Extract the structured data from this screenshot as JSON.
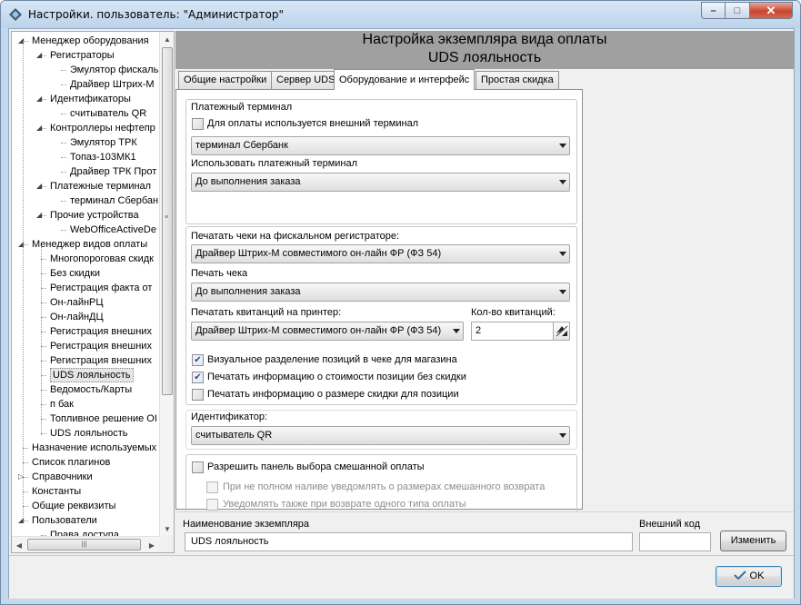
{
  "window": {
    "title": "Настройки. пользователь: \"Администратор\"",
    "buttons": {
      "minimize": "–",
      "maximize": "□",
      "close": "✕"
    }
  },
  "tree": {
    "items": [
      {
        "label": "Менеджер оборудования",
        "level": 0,
        "expander": "minus"
      },
      {
        "label": "Регистраторы",
        "level": 1,
        "expander": "minus"
      },
      {
        "label": "Эмулятор фискаль",
        "level": 2
      },
      {
        "label": "Драйвер Штрих-М",
        "level": 2
      },
      {
        "label": "Идентификаторы",
        "level": 1,
        "expander": "minus"
      },
      {
        "label": "считыватель QR",
        "level": 2
      },
      {
        "label": "Контроллеры нефтепр",
        "level": 1,
        "expander": "minus"
      },
      {
        "label": "Эмулятор ТРК",
        "level": 2
      },
      {
        "label": "Топаз-103МК1",
        "level": 2
      },
      {
        "label": "Драйвер ТРК Прот",
        "level": 2
      },
      {
        "label": "Платежные терминал",
        "level": 1,
        "expander": "minus"
      },
      {
        "label": "терминал Сбербан",
        "level": 2
      },
      {
        "label": "Прочие устройства",
        "level": 1,
        "expander": "minus"
      },
      {
        "label": "WebOfficeActiveDe",
        "level": 2
      },
      {
        "label": "Менеджер видов оплаты",
        "level": 0,
        "expander": "minus"
      },
      {
        "label": "Многопороговая скидк",
        "level": 1
      },
      {
        "label": "Без скидки",
        "level": 1
      },
      {
        "label": "Регистрация факта от",
        "level": 1
      },
      {
        "label": "Он-лайнРЦ",
        "level": 1
      },
      {
        "label": "Он-лайнДЦ",
        "level": 1
      },
      {
        "label": "Регистрация внешних",
        "level": 1
      },
      {
        "label": "Регистрация внешних",
        "level": 1
      },
      {
        "label": "Регистрация внешних",
        "level": 1
      },
      {
        "label": "UDS лояльность",
        "level": 1,
        "selected": true
      },
      {
        "label": "Ведомость/Карты",
        "level": 1
      },
      {
        "label": "п бак",
        "level": 1
      },
      {
        "label": "Топливное решение ОІ",
        "level": 1
      },
      {
        "label": "UDS лояльность",
        "level": 1
      },
      {
        "label": "Назначение используемых",
        "level": 0
      },
      {
        "label": "Список плагинов",
        "level": 0
      },
      {
        "label": "Справочники",
        "level": 0,
        "expander": "plus"
      },
      {
        "label": "Константы",
        "level": 0
      },
      {
        "label": "Общие реквизиты",
        "level": 0
      },
      {
        "label": "Пользователи",
        "level": 0,
        "expander": "minus"
      },
      {
        "label": "Права доступа",
        "level": 1
      }
    ],
    "scroll_grip": "≡",
    "hscroll_grip": "|||"
  },
  "header": {
    "title": "Настройка экземпляра вида оплаты",
    "subtitle": "UDS лояльность"
  },
  "tabs": [
    {
      "label": "Общие настройки",
      "active": false
    },
    {
      "label": "Сервер UDS",
      "active": false
    },
    {
      "label": "Оборудование и интерфейс",
      "active": true
    },
    {
      "label": "Простая скидка",
      "active": false
    }
  ],
  "payment_terminal": {
    "group_label": "Платежный терминал",
    "external_checkbox_label": "Для оплаты используется внешний терминал",
    "external_checked": false,
    "terminal_value": "терминал Сбербанк",
    "use_label": "Использовать платежный терминал",
    "use_value": "До выполнения заказа"
  },
  "fiscal": {
    "print_on_fiscal_label": "Печатать чеки на фискальном регистраторе:",
    "fiscal_value": "Драйвер Штрих-М совместимого он-лайн ФР (ФЗ 54)",
    "receipt_print_label": "Печать чека",
    "receipt_print_value": "До выполнения заказа",
    "receipts_printer_label": "Печатать квитанций на принтер:",
    "receipts_printer_value": "Драйвер Штрих-М совместимого он-лайн ФР (ФЗ 54)",
    "receipts_count_label": "Кол-во квитанций:",
    "receipts_count_value": "2",
    "options": [
      {
        "label": "Визуальное разделение позиций в чеке для магазина",
        "checked": true
      },
      {
        "label": "Печатать информацию о стоимости позиции без скидки",
        "checked": true
      },
      {
        "label": "Печатать информацию о размере скидки для позиции",
        "checked": false
      }
    ]
  },
  "identifier": {
    "label": "Идентификатор:",
    "value": "считыватель QR"
  },
  "mixed_payment": {
    "allow_label": "Разрешить панель выбора смешанной оплаты",
    "allow_checked": false,
    "sub_options": [
      {
        "label": "При не полном наливе уведомлять о размерах смешанного возврата",
        "checked": false,
        "disabled": true
      },
      {
        "label": "Уведомлять также при возврате одного типа оплаты",
        "checked": false,
        "disabled": true
      }
    ]
  },
  "instance": {
    "name_label": "Наименование экземпляра",
    "name_value": "UDS лояльность",
    "ext_code_label": "Внешний код",
    "ext_code_value": "",
    "change_button": "Изменить"
  },
  "footer": {
    "ok_button": "OK"
  },
  "colors": {
    "header_bg": "#a0a0a0",
    "window_frame": "#c5d9ec",
    "check_mark": "#2a4a8b"
  }
}
